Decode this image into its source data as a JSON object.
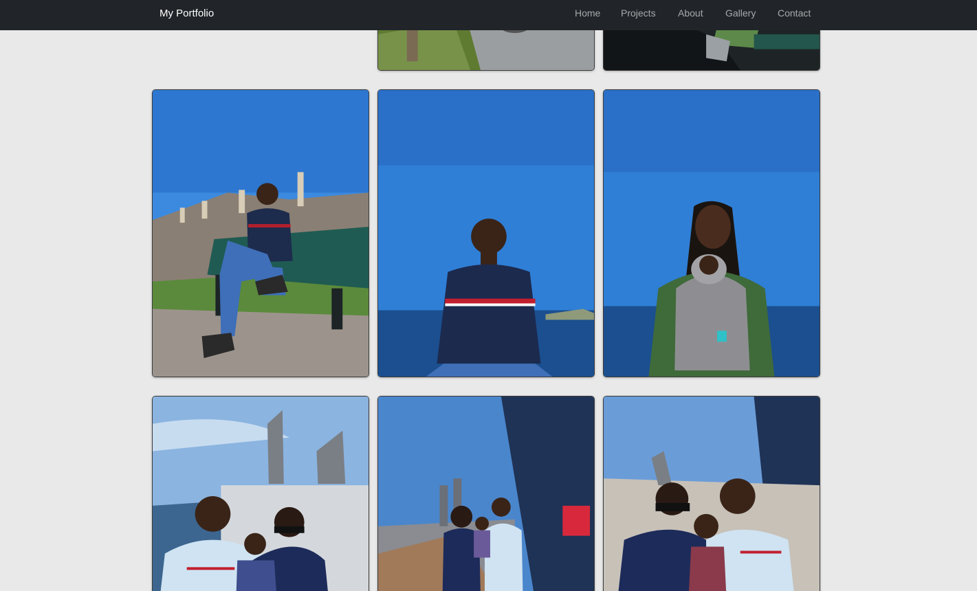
{
  "navbar": {
    "brand": "My Portfolio",
    "links": [
      "Home",
      "Projects",
      "About",
      "Gallery",
      "Contact"
    ]
  },
  "gallery": {
    "rows": [
      [
        "coastal-path-photo",
        "bench-closeup-photo"
      ],
      [
        "man-on-bench-photo",
        "man-by-ocean-photo",
        "woman-with-baby-photo"
      ],
      [
        "family-ferry-photo",
        "family-deck-photo",
        "family-deck-closeup-photo"
      ]
    ]
  },
  "colors": {
    "navbar": "#212529",
    "background": "#e9e9e9",
    "sky": "#2f7fd6",
    "ocean": "#1b4f8f"
  }
}
